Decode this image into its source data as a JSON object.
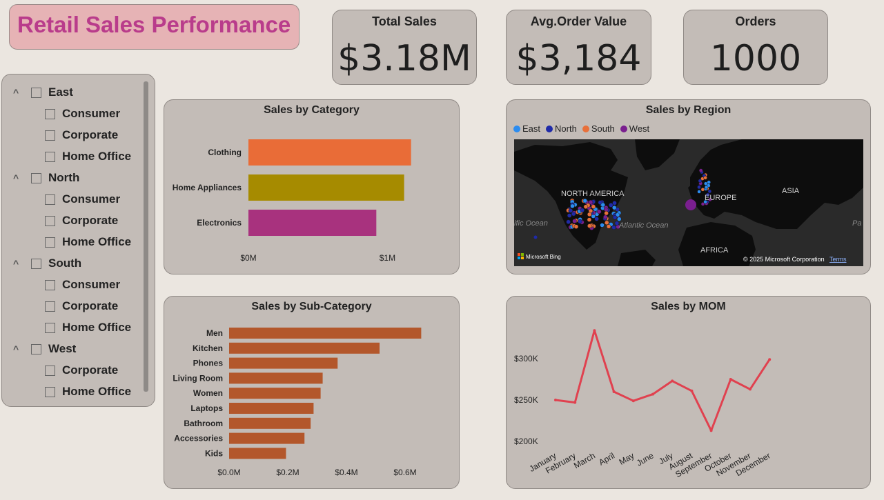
{
  "header": {
    "title": "Retail Sales Performance"
  },
  "kpis": [
    {
      "label": "Total Sales",
      "value": "$3.18M"
    },
    {
      "label": "Avg.Order Value",
      "value": "$3,184"
    },
    {
      "label": "Orders",
      "value": "1000"
    }
  ],
  "slicer": {
    "regions": [
      {
        "name": "East",
        "segments": [
          "Consumer",
          "Corporate",
          "Home Office"
        ]
      },
      {
        "name": "North",
        "segments": [
          "Consumer",
          "Corporate",
          "Home Office"
        ]
      },
      {
        "name": "South",
        "segments": [
          "Consumer",
          "Corporate",
          "Home Office"
        ]
      },
      {
        "name": "West",
        "segments": [
          "Corporate",
          "Home Office"
        ]
      }
    ]
  },
  "category_chart": {
    "title": "Sales by Category"
  },
  "region_map": {
    "title": "Sales by Region",
    "legend": [
      {
        "name": "East",
        "color": "#2b8cf0"
      },
      {
        "name": "North",
        "color": "#1f2aa8"
      },
      {
        "name": "South",
        "color": "#e8703a"
      },
      {
        "name": "West",
        "color": "#7a1f8f"
      }
    ],
    "labels": {
      "north_america": "NORTH AMERICA",
      "europe": "EUROPE",
      "asia": "ASIA",
      "africa": "AFRICA",
      "atlantic": "Atlantic Ocean",
      "pacific_left": "ific Ocean",
      "pacific_right": "Pa",
      "bing": "Microsoft Bing",
      "copyright": "© 2025 Microsoft Corporation",
      "terms": "Terms"
    }
  },
  "subcategory_chart": {
    "title": "Sales by Sub-Category"
  },
  "mom_chart": {
    "title": "Sales by MOM"
  },
  "chart_data": [
    {
      "type": "bar",
      "orientation": "horizontal",
      "title": "Sales by Category",
      "categories": [
        "Clothing",
        "Home Appliances",
        "Electronics"
      ],
      "values": [
        1.17,
        1.12,
        0.92
      ],
      "colors": [
        "#e96c37",
        "#a68b00",
        "#a8327e"
      ],
      "xlim": [
        0,
        1.4
      ],
      "ticks": [
        0,
        1
      ],
      "tick_labels": [
        "$0M",
        "$1M"
      ]
    },
    {
      "type": "bar",
      "orientation": "horizontal",
      "title": "Sales by Sub-Category",
      "categories": [
        "Men",
        "Kitchen",
        "Phones",
        "Living Room",
        "Women",
        "Laptops",
        "Bathroom",
        "Accessories",
        "Kids"
      ],
      "values": [
        0.655,
        0.513,
        0.37,
        0.319,
        0.312,
        0.288,
        0.278,
        0.257,
        0.194
      ],
      "color": "#b3572b",
      "xlim": [
        0,
        0.72
      ],
      "ticks": [
        0,
        0.2,
        0.4,
        0.6
      ],
      "tick_labels": [
        "$0.0M",
        "$0.2M",
        "$0.4M",
        "$0.6M"
      ]
    },
    {
      "type": "line",
      "title": "Sales by MOM",
      "x": [
        "January",
        "February",
        "March",
        "April",
        "May",
        "June",
        "July",
        "August",
        "September",
        "October",
        "November",
        "December"
      ],
      "values": [
        250000,
        247000,
        334000,
        260000,
        249000,
        257000,
        273000,
        261000,
        213000,
        275000,
        263000,
        299000
      ],
      "color": "#e0414f",
      "ylim": [
        190000,
        350000
      ],
      "yticks": [
        200000,
        250000,
        300000
      ],
      "ytick_labels": [
        "$200K",
        "$250K",
        "$300K"
      ]
    }
  ]
}
